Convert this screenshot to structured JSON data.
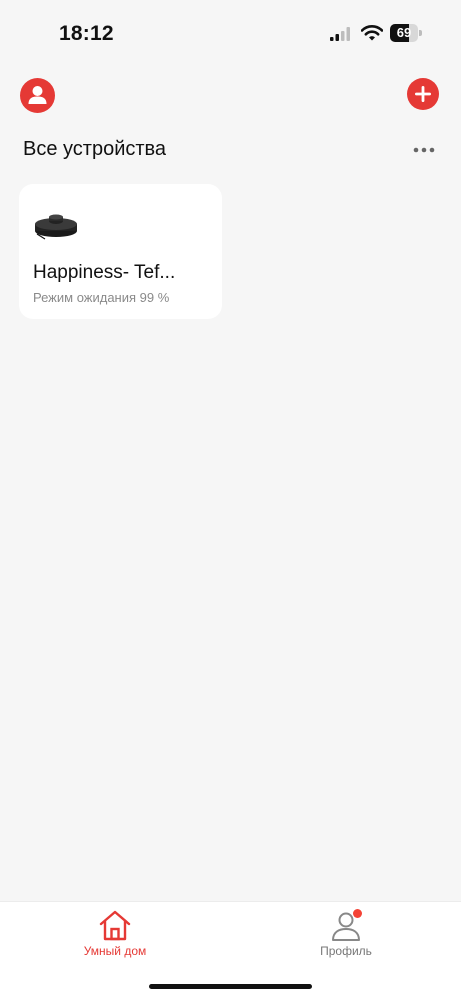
{
  "status_bar": {
    "time": "18:12",
    "battery_percent": "69",
    "battery_level": 0.69,
    "icons": [
      "cellular-signal-icon",
      "wifi-icon",
      "battery-icon"
    ]
  },
  "header": {
    "profile_icon": "user-icon",
    "add_icon": "plus-icon"
  },
  "section": {
    "title": "Все устройства",
    "more_icon": "ellipsis-icon"
  },
  "devices": [
    {
      "name": "Happiness- Tef...",
      "status": "Режим ожидания  99 %",
      "icon": "robot-vacuum-image"
    }
  ],
  "tab_bar": {
    "tabs": [
      {
        "label": "Умный дом",
        "icon": "home-icon",
        "active": true
      },
      {
        "label": "Профиль",
        "icon": "profile-icon",
        "badge": true
      }
    ]
  },
  "colors": {
    "accent": "#e53935",
    "background": "#f6f6f6",
    "card": "#ffffff",
    "muted_text": "#8a8a8a"
  }
}
